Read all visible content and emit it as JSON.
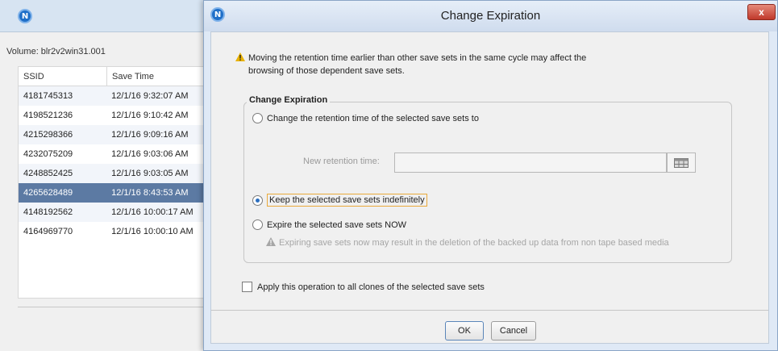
{
  "background_window": {
    "volume_label": "Volume:  blr2v2win31.001",
    "table": {
      "columns": [
        "SSID",
        "Save Time"
      ],
      "rows": [
        {
          "ssid": "4181745313",
          "save_time": "12/1/16 9:32:07 AM"
        },
        {
          "ssid": "4198521236",
          "save_time": "12/1/16 9:10:42 AM"
        },
        {
          "ssid": "4215298366",
          "save_time": "12/1/16 9:09:16 AM"
        },
        {
          "ssid": "4232075209",
          "save_time": "12/1/16 9:03:06 AM"
        },
        {
          "ssid": "4248852425",
          "save_time": "12/1/16 9:03:05 AM"
        },
        {
          "ssid": "4265628489",
          "save_time": "12/1/16 8:43:53 AM"
        },
        {
          "ssid": "4148192562",
          "save_time": "12/1/16 10:00:17 AM"
        },
        {
          "ssid": "4164969770",
          "save_time": "12/1/16 10:00:10 AM"
        }
      ],
      "selected_index": 5
    }
  },
  "dialog": {
    "logo_letter": "N",
    "title": "Change Expiration",
    "close_label": "x",
    "warning_line1": "Moving the retention time earlier than other save sets in the same cycle may affect the",
    "warning_line2": "browsing of those dependent save sets.",
    "group_title": "Change Expiration",
    "options": {
      "change_label": "Change the retention time of the selected save sets to",
      "retention_label": "New retention time:",
      "retention_value": "",
      "keep_label": "Keep the selected save sets indefinitely",
      "expire_label": "Expire the selected save sets NOW",
      "expire_warning": "Expiring save sets now may result in the deletion of the backed up data from non tape based media",
      "selected": "keep"
    },
    "apply_all_label": "Apply this operation to all clones of the selected save sets",
    "apply_all_checked": false,
    "ok_label": "OK",
    "cancel_label": "Cancel"
  },
  "colors": {
    "selection": "#5c7aa3",
    "warning": "#e8b100",
    "close_button": "#c0392b"
  }
}
